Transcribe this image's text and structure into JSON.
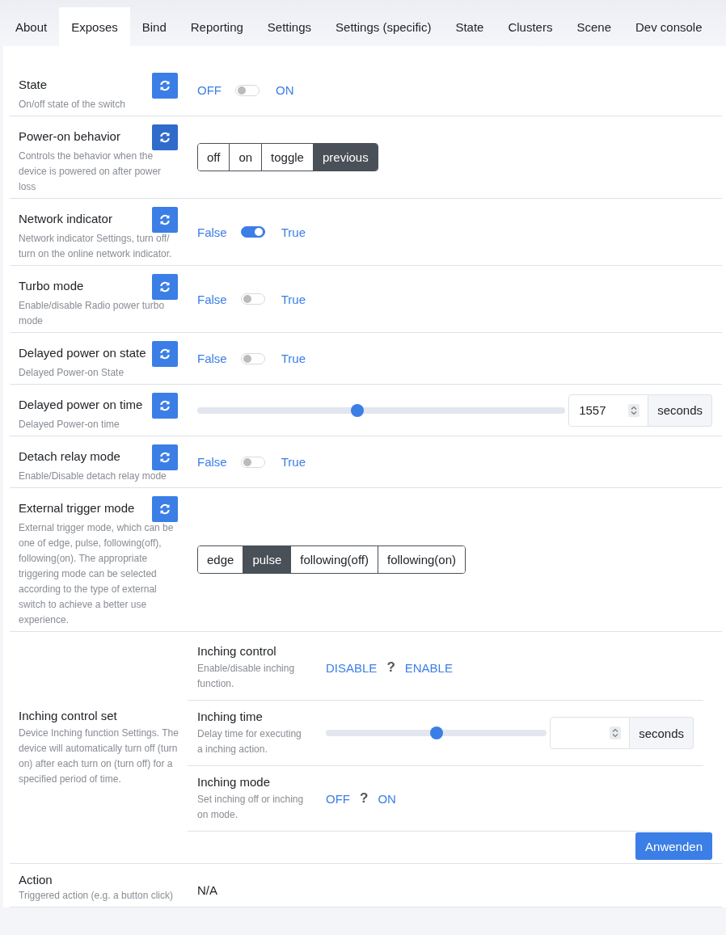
{
  "tabs": [
    {
      "label": "About",
      "selected": false
    },
    {
      "label": "Exposes",
      "selected": true
    },
    {
      "label": "Bind",
      "selected": false
    },
    {
      "label": "Reporting",
      "selected": false
    },
    {
      "label": "Settings",
      "selected": false
    },
    {
      "label": "Settings (specific)",
      "selected": false
    },
    {
      "label": "State",
      "selected": false
    },
    {
      "label": "Clusters",
      "selected": false
    },
    {
      "label": "Scene",
      "selected": false
    },
    {
      "label": "Dev console",
      "selected": false
    }
  ],
  "rows": [
    {
      "kind": "toggle",
      "title": "State",
      "description": "On/off state of the switch",
      "refresh_active": false,
      "off_label": "OFF",
      "on_label": "ON",
      "on": false
    },
    {
      "kind": "enum",
      "title": "Power-on behavior",
      "description": "Controls the behavior when the device is powered on after power loss",
      "refresh_active": true,
      "options": [
        {
          "label": "off",
          "selected": false
        },
        {
          "label": "on",
          "selected": false
        },
        {
          "label": "toggle",
          "selected": false
        },
        {
          "label": "previous",
          "selected": true
        }
      ]
    },
    {
      "kind": "toggle",
      "title": "Network indicator",
      "description": "Network indicator Settings, turn off/ turn on the online network indicator.",
      "refresh_active": false,
      "off_label": "False",
      "on_label": "True",
      "on": true
    },
    {
      "kind": "toggle",
      "title": "Turbo mode",
      "description": "Enable/disable Radio power turbo mode",
      "refresh_active": false,
      "off_label": "False",
      "on_label": "True",
      "on": false
    },
    {
      "kind": "toggle",
      "title": "Delayed power on state",
      "description": "Delayed Power-on State",
      "refresh_active": false,
      "off_label": "False",
      "on_label": "True",
      "on": false
    },
    {
      "kind": "slider",
      "title": "Delayed power on time",
      "description": "Delayed Power-on time",
      "refresh_active": false,
      "level": 0.434,
      "value": "1557",
      "unit": "seconds"
    },
    {
      "kind": "toggle",
      "title": "Detach relay mode",
      "description": "Enable/Disable detach relay mode",
      "refresh_active": false,
      "off_label": "False",
      "on_label": "True",
      "on": false
    },
    {
      "kind": "enum",
      "title": "External trigger mode",
      "description": "External trigger mode, which can be one of edge, pulse, following(off), following(on). The appropriate triggering mode can be selected according to the type of external switch to achieve a better use experience.",
      "refresh_active": false,
      "options": [
        {
          "label": "edge",
          "selected": false
        },
        {
          "label": "pulse",
          "selected": true
        },
        {
          "label": "following(off)",
          "selected": false
        },
        {
          "label": "following(on)",
          "selected": false
        }
      ]
    },
    {
      "kind": "composite",
      "title": "Inching control set",
      "description": "Device Inching function Settings. The device will automatically turn off (turn on) after each turn on (turn off) for a specified period of time.",
      "apply_label": "Anwenden",
      "children": [
        {
          "kind": "tristate",
          "title": "Inching control",
          "description": "Enable/disable inching function.",
          "off_label": "DISABLE",
          "unknown_label": "?",
          "on_label": "ENABLE"
        },
        {
          "kind": "slider",
          "title": "Inching time",
          "description": "Delay time for executing a inching action.",
          "level": 0.5,
          "unit": "seconds"
        },
        {
          "kind": "tristate",
          "title": "Inching mode",
          "description": "Set inching off or inching on mode.",
          "off_label": "OFF",
          "unknown_label": "?",
          "on_label": "ON"
        }
      ]
    },
    {
      "kind": "text",
      "title": "Action",
      "description": "Triggered action (e.g. a button click)",
      "value": "N/A"
    }
  ]
}
